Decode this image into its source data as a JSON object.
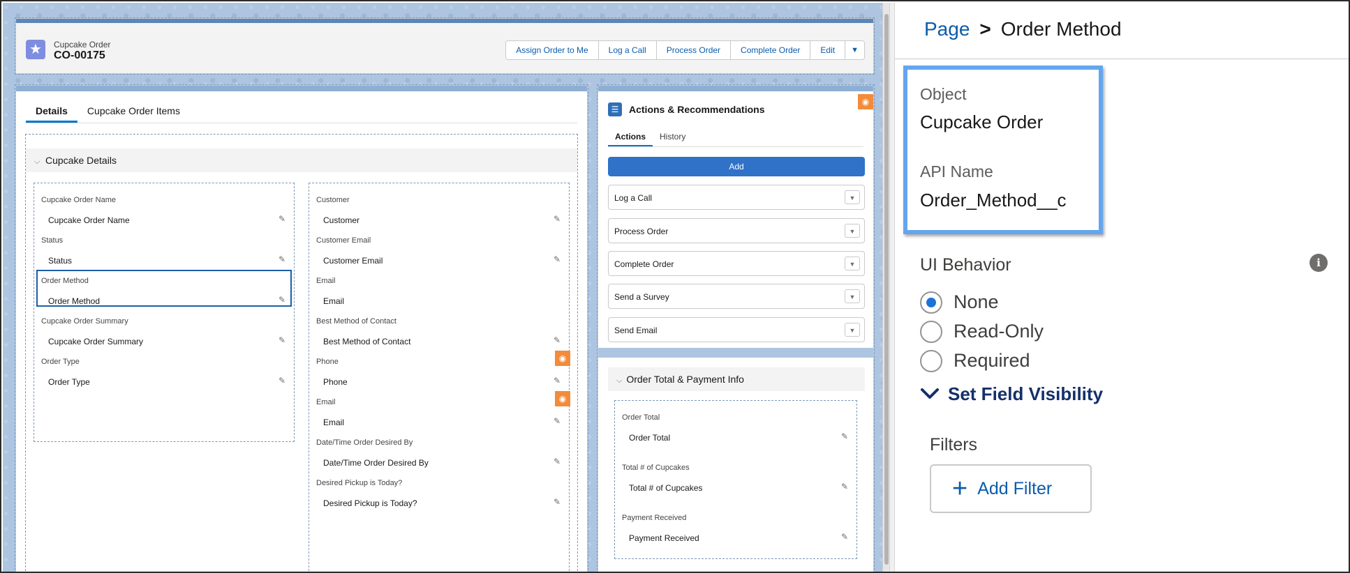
{
  "record": {
    "type_label": "Cupcake Order",
    "name": "CO-00175",
    "icon": "star-icon",
    "actions": [
      "Assign Order to Me",
      "Log a Call",
      "Process Order",
      "Complete Order",
      "Edit"
    ]
  },
  "details": {
    "tabs": [
      "Details",
      "Cupcake Order Items"
    ],
    "active_tab": "Details",
    "section_title": "Cupcake Details",
    "left_fields": [
      {
        "label": "Cupcake Order Name",
        "value": "Cupcake Order Name",
        "editable": true
      },
      {
        "label": "Status",
        "value": "Status",
        "editable": true
      },
      {
        "label": "Order Method",
        "value": "Order Method",
        "editable": true,
        "selected": true
      },
      {
        "label": "Cupcake Order Summary",
        "value": "Cupcake Order Summary",
        "editable": true
      },
      {
        "label": "Order Type",
        "value": "Order Type",
        "editable": true
      }
    ],
    "right_fields": [
      {
        "label": "Customer",
        "value": "Customer",
        "editable": true
      },
      {
        "label": "Customer Email",
        "value": "Customer Email",
        "editable": true
      },
      {
        "label": "Email",
        "value": "Email",
        "editable": false
      },
      {
        "label": "Best Method of Contact",
        "value": "Best Method of Contact",
        "editable": true
      },
      {
        "label": "Phone",
        "value": "Phone",
        "editable": true,
        "visibility_rule": true
      },
      {
        "label": "Email",
        "value": "Email",
        "editable": true,
        "visibility_rule": true
      },
      {
        "label": "Date/Time Order Desired By",
        "value": "Date/Time Order Desired By",
        "editable": true
      },
      {
        "label": "Desired Pickup is Today?",
        "value": "Desired Pickup is Today?",
        "editable": true
      }
    ]
  },
  "actions_panel": {
    "title": "Actions & Recommendations",
    "tabs": [
      "Actions",
      "History"
    ],
    "active_tab": "Actions",
    "add_label": "Add",
    "items": [
      "Log a Call",
      "Process Order",
      "Complete Order",
      "Send a Survey",
      "Send Email"
    ],
    "order_section_title": "Order Total & Payment Info",
    "order_fields": [
      {
        "label": "Order Total",
        "value": "Order Total"
      },
      {
        "label": "Total # of Cupcakes",
        "value": "Total # of Cupcakes"
      },
      {
        "label": "Payment Received",
        "value": "Payment Received"
      }
    ]
  },
  "properties": {
    "breadcrumb_root": "Page",
    "breadcrumb_sep": ">",
    "breadcrumb_current": "Order Method",
    "object_label": "Object",
    "object_value": "Cupcake Order",
    "api_label": "API Name",
    "api_value": "Order_Method__c",
    "ui_behavior_label": "UI Behavior",
    "ui_behavior_options": [
      "None",
      "Read-Only",
      "Required"
    ],
    "ui_behavior_selected": "None",
    "visibility_label": "Set Field Visibility",
    "filters_label": "Filters",
    "add_filter_label": "Add Filter"
  },
  "colors": {
    "accent": "#0176d3",
    "highlight_border": "#63a6f0",
    "visibility_badge": "#f38b3a",
    "canvas_background": "#adc5e1"
  }
}
